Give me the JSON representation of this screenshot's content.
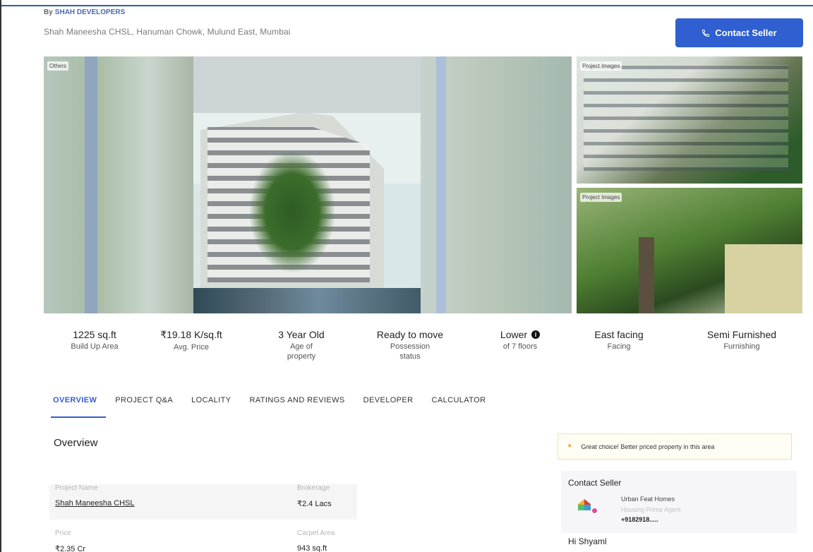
{
  "header": {
    "by_label": "By",
    "developer": "SHAH DEVELOPERS",
    "address": "Shah Maneesha CHSL, Hanuman Chowk, Mulund East, Mumbai",
    "contact_button": "Contact Seller"
  },
  "gallery": {
    "main_tag": "Others",
    "side_tags": [
      "Project Images",
      "Project Images"
    ]
  },
  "stats": [
    {
      "value": "1225 sq.ft",
      "label": "Build Up Area"
    },
    {
      "value": "₹19.18 K/sq.ft",
      "label": "Avg. Price"
    },
    {
      "value": "3 Year Old",
      "label": "Age of property"
    },
    {
      "value": "Ready to move",
      "label": "Possession status"
    },
    {
      "value": "Lower",
      "label": "of 7 floors"
    },
    {
      "value": "East facing",
      "label": "Facing"
    },
    {
      "value": "Semi Furnished",
      "label": "Furnishing"
    }
  ],
  "tabs": [
    "OVERVIEW",
    "PROJECT Q&A",
    "LOCALITY",
    "RATINGS AND REVIEWS",
    "DEVELOPER",
    "CALCULATOR"
  ],
  "overview": {
    "title": "Overview",
    "project_name_label": "Project Name",
    "project_name": "Shah Maneesha CHSL",
    "brokerage_label": "Brokerage",
    "brokerage": "₹2.4 Lacs",
    "price_label": "Price",
    "price": "₹2.35 Cr",
    "carpet_area_label": "Carpet Area",
    "carpet_area": "943 sq.ft"
  },
  "sidebar": {
    "choice_text": "Great choice! Better priced property in this area",
    "contact_title": "Contact Seller",
    "seller_name": "Urban Feat Homes",
    "seller_role": "Housing Prime Agent",
    "seller_phone": "+9182918.....",
    "greeting": "Hi Shyaml"
  },
  "colors": {
    "accent": "#2f5fd0",
    "choice_border": "#f1e3a8"
  }
}
